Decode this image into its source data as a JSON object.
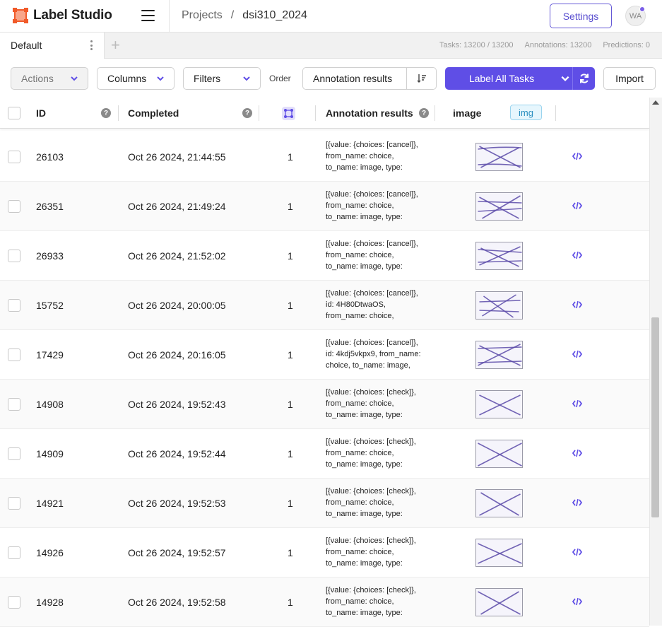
{
  "app": {
    "name": "Label Studio"
  },
  "breadcrumb": {
    "root": "Projects",
    "separator": "/",
    "current": "dsi310_2024"
  },
  "header": {
    "settings_label": "Settings",
    "avatar_initials": "WA"
  },
  "tabs": {
    "active_label": "Default"
  },
  "stats": {
    "tasks": "Tasks: 13200 / 13200",
    "annotations": "Annotations: 13200",
    "predictions": "Predictions: 0"
  },
  "toolbar": {
    "actions_label": "Actions",
    "columns_label": "Columns",
    "filters_label": "Filters",
    "order_label": "Order",
    "order_value": "Annotation results",
    "label_all_label": "Label All Tasks",
    "import_label": "Import"
  },
  "table": {
    "headers": {
      "id": "ID",
      "completed": "Completed",
      "annotation_results": "Annotation results",
      "image": "image",
      "image_badge": "img"
    },
    "rows": [
      {
        "id": "26103",
        "completed": "Oct 26 2024, 21:44:55",
        "count": "1",
        "ann": [
          "[{value: {choices: [cancel]},",
          "from_name: choice,",
          "to_name: image, type:"
        ]
      },
      {
        "id": "26351",
        "completed": "Oct 26 2024, 21:49:24",
        "count": "1",
        "ann": [
          "[{value: {choices: [cancel]},",
          "from_name: choice,",
          "to_name: image, type:"
        ]
      },
      {
        "id": "26933",
        "completed": "Oct 26 2024, 21:52:02",
        "count": "1",
        "ann": [
          "[{value: {choices: [cancel]},",
          "from_name: choice,",
          "to_name: image, type:"
        ]
      },
      {
        "id": "15752",
        "completed": "Oct 26 2024, 20:00:05",
        "count": "1",
        "ann": [
          "[{value: {choices: [cancel]},",
          "id: 4H80DtwaOS,",
          "from_name: choice,"
        ]
      },
      {
        "id": "17429",
        "completed": "Oct 26 2024, 20:16:05",
        "count": "1",
        "ann": [
          "[{value: {choices: [cancel]},",
          "id: 4kdj5vkpx9, from_name:",
          "choice, to_name: image,"
        ]
      },
      {
        "id": "14908",
        "completed": "Oct 26 2024, 19:52:43",
        "count": "1",
        "ann": [
          "[{value: {choices: [check]},",
          "from_name: choice,",
          "to_name: image, type:"
        ]
      },
      {
        "id": "14909",
        "completed": "Oct 26 2024, 19:52:44",
        "count": "1",
        "ann": [
          "[{value: {choices: [check]},",
          "from_name: choice,",
          "to_name: image, type:"
        ]
      },
      {
        "id": "14921",
        "completed": "Oct 26 2024, 19:52:53",
        "count": "1",
        "ann": [
          "[{value: {choices: [check]},",
          "from_name: choice,",
          "to_name: image, type:"
        ]
      },
      {
        "id": "14926",
        "completed": "Oct 26 2024, 19:52:57",
        "count": "1",
        "ann": [
          "[{value: {choices: [check]},",
          "from_name: choice,",
          "to_name: image, type:"
        ]
      },
      {
        "id": "14928",
        "completed": "Oct 26 2024, 19:52:58",
        "count": "1",
        "ann": [
          "[{value: {choices: [check]},",
          "from_name: choice,",
          "to_name: image, type:"
        ]
      }
    ]
  },
  "colors": {
    "accent": "#5f4ee6",
    "brand": "#f15a29",
    "thumbnail_ink": "#5a4aa8"
  }
}
